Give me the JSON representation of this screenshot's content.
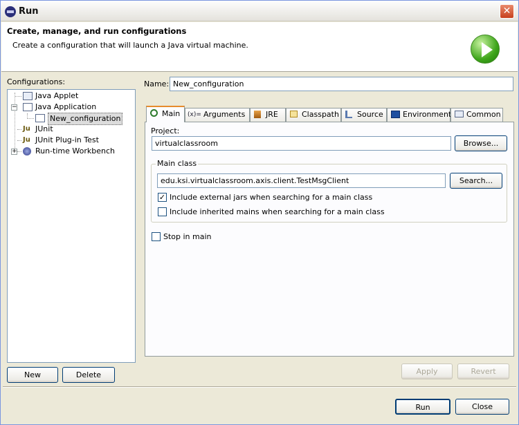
{
  "window": {
    "title": "Run",
    "close_label": "✕"
  },
  "header": {
    "title": "Create, manage, and run configurations",
    "subtitle": "Create a configuration that will launch a Java virtual machine."
  },
  "configurations": {
    "label": "Configurations:",
    "items": [
      {
        "label": "Java Applet",
        "icon": "java-applet-icon"
      },
      {
        "label": "Java Application",
        "icon": "java-application-icon"
      },
      {
        "label": "New_configuration",
        "icon": "java-app-config-icon"
      },
      {
        "label": "JUnit",
        "icon": "junit-icon"
      },
      {
        "label": "JUnit Plug-in Test",
        "icon": "junit-plugin-icon"
      },
      {
        "label": "Run-time Workbench",
        "icon": "workbench-icon"
      }
    ],
    "new_button": "New",
    "delete_button": "Delete"
  },
  "name": {
    "label": "Name:",
    "value": "New_configuration"
  },
  "tabs": [
    {
      "label": "Main",
      "icon": "main-tab-icon"
    },
    {
      "label": "Arguments",
      "icon": "arguments-tab-icon",
      "icon_text": "(x)="
    },
    {
      "label": "JRE",
      "icon": "jre-tab-icon"
    },
    {
      "label": "Classpath",
      "icon": "classpath-tab-icon"
    },
    {
      "label": "Source",
      "icon": "source-tab-icon"
    },
    {
      "label": "Environment",
      "icon": "environment-tab-icon"
    },
    {
      "label": "Common",
      "icon": "common-tab-icon"
    }
  ],
  "main": {
    "project_label": "Project:",
    "project_value": "virtualclassroom",
    "browse_button": "Browse...",
    "main_class_group": "Main class",
    "main_class_value": "edu.ksi.virtualclassroom.axis.client.TestMsgClient",
    "search_button": "Search...",
    "include_external_jars": {
      "label": "Include external jars when searching for a main class",
      "checked": true
    },
    "include_inherited_mains": {
      "label": "Include inherited mains when searching for a main class",
      "checked": false
    },
    "stop_in_main": {
      "label": "Stop in main",
      "checked": false
    }
  },
  "actions": {
    "apply": "Apply",
    "revert": "Revert",
    "run": "Run",
    "close": "Close"
  },
  "colors": {
    "accent": "#e68b2c",
    "titlebar": "#e4e2dc",
    "panel": "#ece9d8",
    "run_green": "#3ea51a"
  }
}
